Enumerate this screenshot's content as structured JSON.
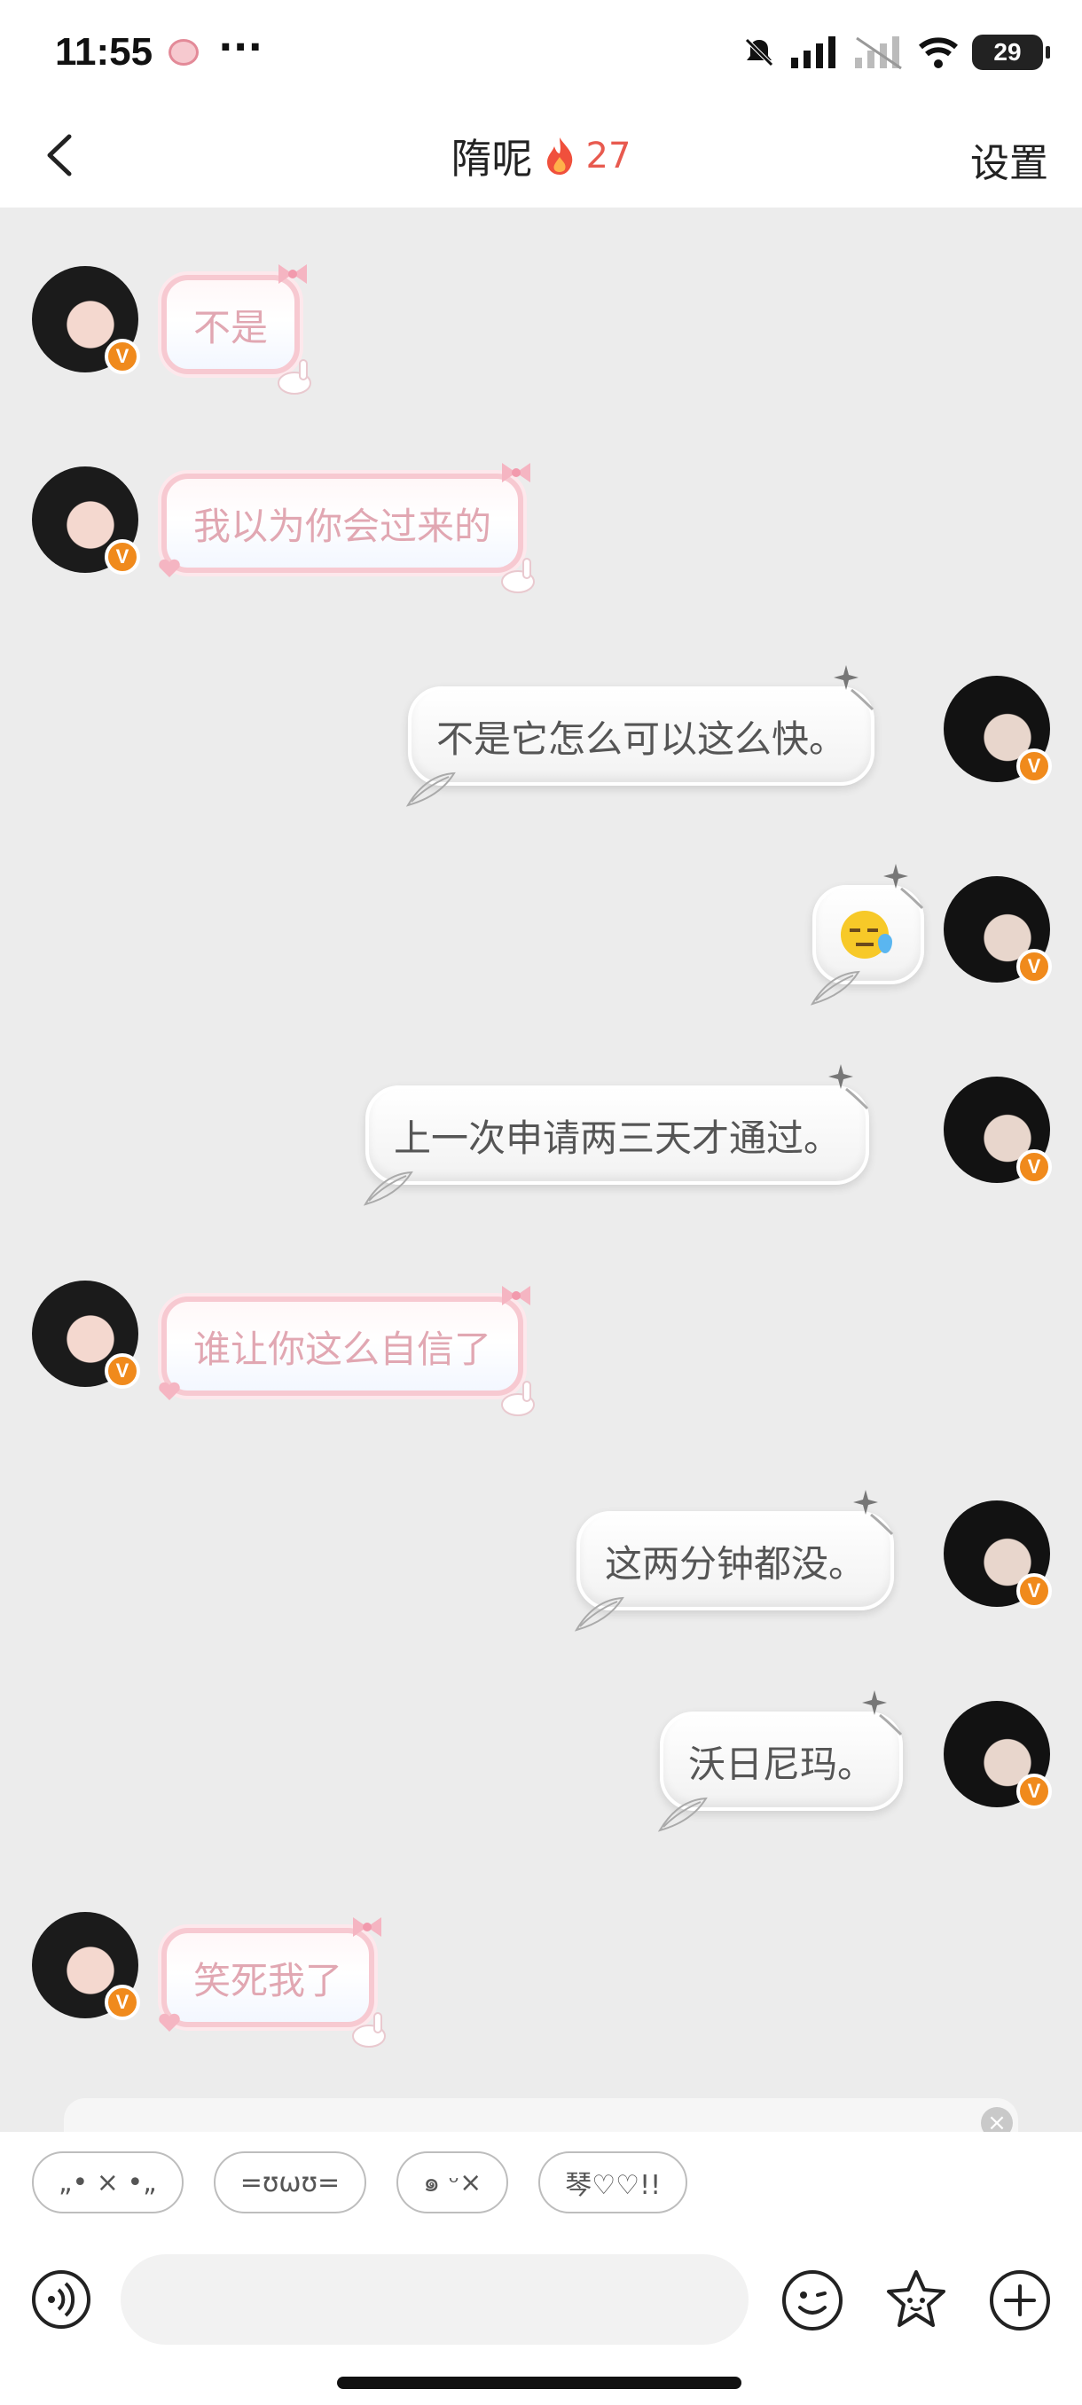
{
  "status_bar": {
    "time": "11:55",
    "more": "···",
    "battery": "29"
  },
  "header": {
    "title": "隋呢",
    "streak_count": "27",
    "settings_label": "设置"
  },
  "verified_badge": "V",
  "messages": [
    {
      "side": "left",
      "text": "不是"
    },
    {
      "side": "left",
      "text": "我以为你会过来的"
    },
    {
      "side": "right",
      "text": "不是它怎么可以这么快。"
    },
    {
      "side": "right",
      "text": "",
      "emoji": "downcast-sweat-face"
    },
    {
      "side": "right",
      "text": "上一次申请两三天才通过。"
    },
    {
      "side": "left",
      "text": "谁让你这么自信了"
    },
    {
      "side": "right",
      "text": "这两分钟都没。"
    },
    {
      "side": "right",
      "text": "沃日尼玛。"
    },
    {
      "side": "left",
      "text": "笑死我了"
    }
  ],
  "suggestion_close": "×",
  "quick_replies": [
    "„• × •„",
    "=ʊωʊ=",
    "๑ ᵕ×",
    "琴♡♡!!"
  ],
  "input": {
    "value": "",
    "placeholder": ""
  },
  "colors": {
    "chat_background": "#ececec",
    "pink_bubble_text": "#e1a7b2",
    "white_bubble_text": "#555555",
    "streak": "#e85a4f",
    "badge": "#f08a1c"
  }
}
